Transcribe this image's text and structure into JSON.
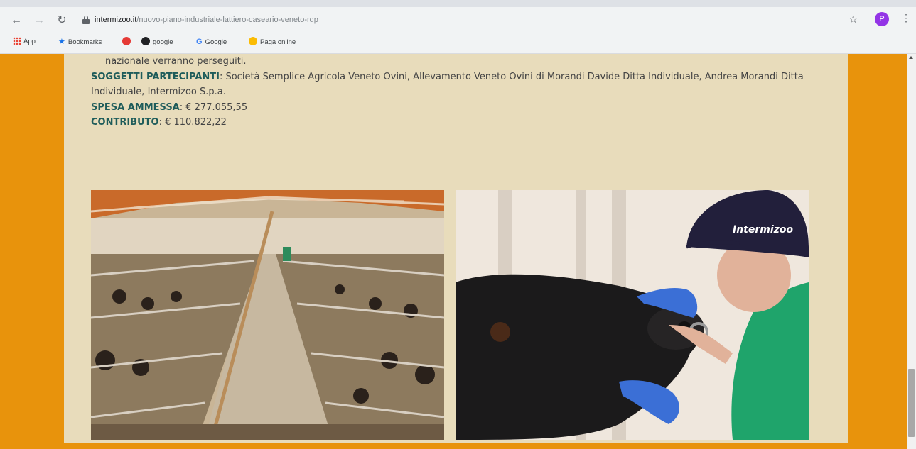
{
  "browser": {
    "url_domain": "intermizoo.it",
    "url_path": "/nuovo-piano-industriale-lattiero-caseario-veneto-rdp",
    "profile_initial": "P",
    "bookmarks": [
      {
        "label": "App",
        "icon": "apps-grid-icon"
      },
      {
        "label": "Bookmarks",
        "icon": "star-icon"
      },
      {
        "label": "",
        "icon": "red-circle-icon"
      },
      {
        "label": "google",
        "icon": "globe-icon"
      },
      {
        "label": "Google",
        "icon": "google-g-icon"
      },
      {
        "label": "Paga online",
        "icon": "paga-online-icon"
      }
    ]
  },
  "article": {
    "line_partial": "nazionale verranno perseguiti.",
    "soggetti_label": "SOGGETTI PARTECIPANTI",
    "soggetti_value": ": Società Semplice Agricola Veneto Ovini, Allevamento Veneto Ovini di Morandi Davide Ditta Individuale, Andrea Morandi Ditta Individuale, Intermizoo S.p.a.",
    "spesa_label": "SPESA AMMESSA",
    "spesa_value": ": € 277.055,55",
    "contributo_label": "CONTRIBUTO",
    "contributo_value": ": € 110.822,22"
  },
  "images": {
    "left_alt": "barn interior photo",
    "right_alt": "bull and handler photo",
    "cap_logo": "Intermizoo"
  },
  "colors": {
    "page_bg": "#e8930c",
    "content_bg": "#e8dcbb",
    "label": "#1e5c5a"
  }
}
